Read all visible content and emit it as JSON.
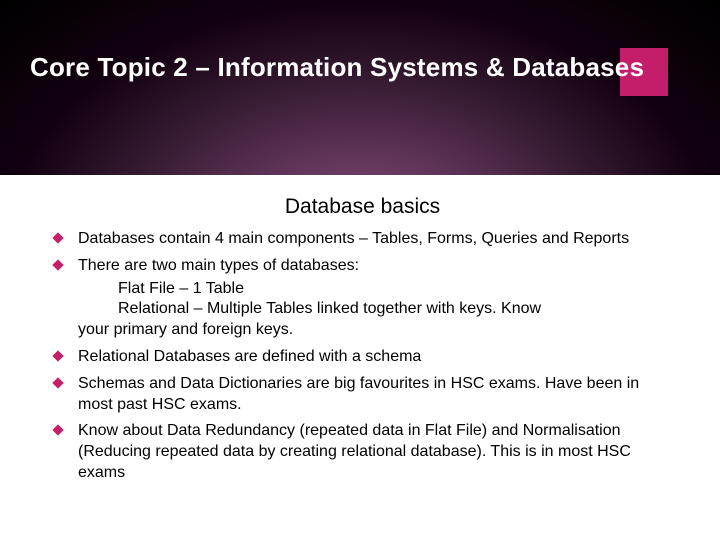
{
  "title": "Core Topic 2 – Information Systems & Databases",
  "subtitle": "Database basics",
  "accent_color": "#c41e6a",
  "bullets": [
    {
      "text": "Databases contain 4 main components – Tables, Forms, Queries and Reports"
    },
    {
      "text": "There are two main types of databases:",
      "sub": [
        "Flat File – 1 Table",
        "Relational – Multiple Tables linked together with keys.  Know",
        "your primary and foreign keys."
      ]
    },
    {
      "text": "Relational Databases are defined with a schema"
    },
    {
      "text": "Schemas and Data Dictionaries are big favourites in HSC exams.  Have been in most past HSC exams."
    },
    {
      "text": "Know about Data Redundancy (repeated data in Flat File) and Normalisation (Reducing repeated data by creating relational database).  This is in most HSC exams"
    }
  ]
}
